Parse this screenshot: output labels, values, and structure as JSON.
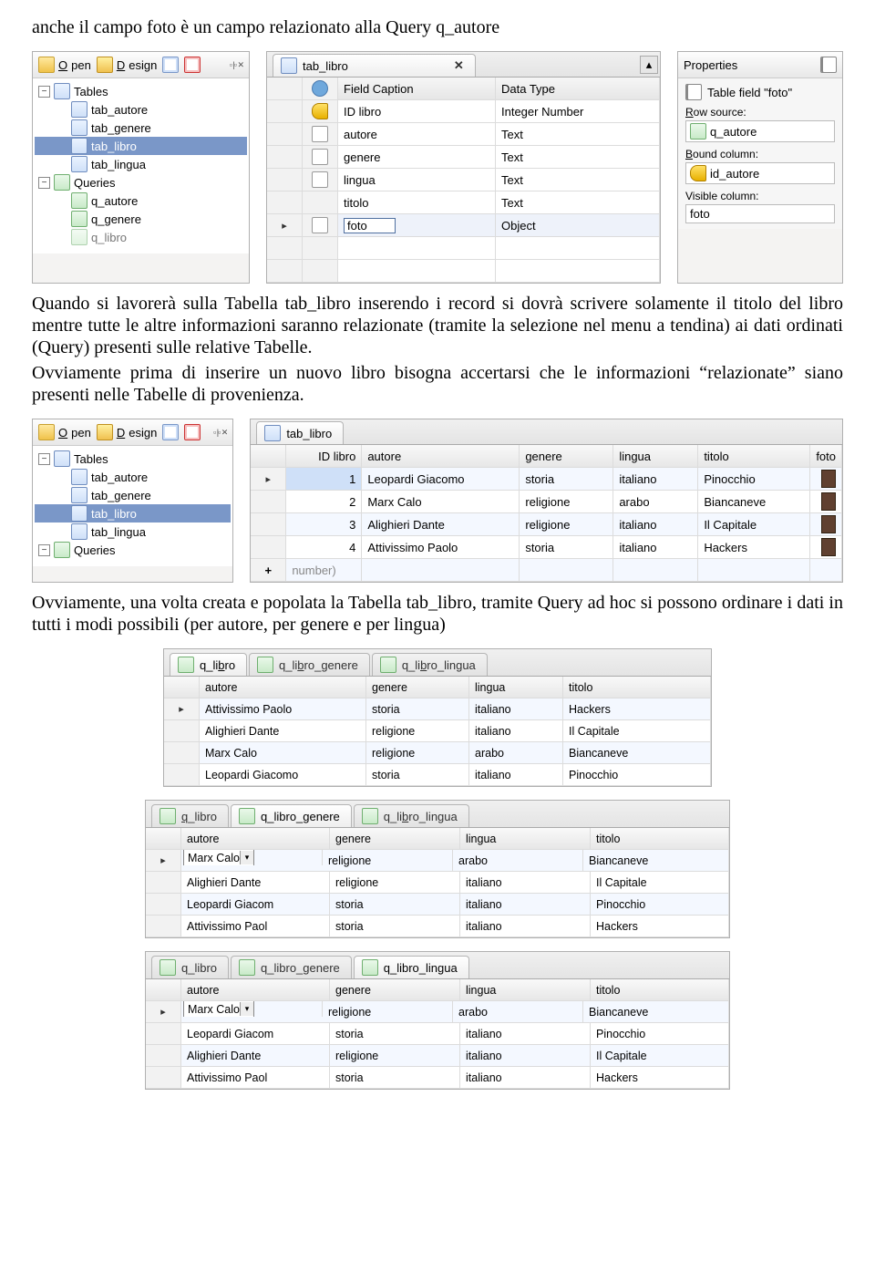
{
  "para1": "anche il campo foto è un campo relazionato alla Query q_autore",
  "para2": "Quando si lavorerà sulla Tabella tab_libro inserendo i record si dovrà scrivere solamente il titolo del libro mentre tutte le altre informazioni saranno relazionate (tramite la selezione nel menu a tendina) ai dati ordinati (Query) presenti sulle relative Tabelle.",
  "para3": "Ovviamente prima di inserire un nuovo libro bisogna accertarsi che le informazioni “relazionate” siano presenti nelle Tabelle di provenienza.",
  "para4": "Ovviamente, una volta creata e popolata la Tabella tab_libro, tramite Query ad hoc si possono ordinare i dati in tutti i modi possibili (per autore, per genere e per lingua)",
  "toolbar": {
    "open": "Open",
    "design": "Design"
  },
  "tree": {
    "tables_label": "Tables",
    "tables": [
      "tab_autore",
      "tab_genere",
      "tab_libro",
      "tab_lingua"
    ],
    "tables_selected": "tab_libro",
    "queries_label": "Queries",
    "queries": [
      "q_autore",
      "q_genere",
      "q_libro"
    ]
  },
  "design": {
    "tab": "tab_libro",
    "col_caption": "Field Caption",
    "col_type": "Data Type",
    "rows": [
      {
        "icon": "key",
        "name": "ID libro",
        "type": "Integer Number"
      },
      {
        "icon": "field",
        "name": "autore",
        "type": "Text"
      },
      {
        "icon": "field",
        "name": "genere",
        "type": "Text"
      },
      {
        "icon": "field",
        "name": "lingua",
        "type": "Text"
      },
      {
        "icon": "",
        "name": "titolo",
        "type": "Text"
      },
      {
        "icon": "field",
        "name": "foto",
        "type": "Object",
        "current": true
      }
    ]
  },
  "props": {
    "title": "Properties",
    "subtitle": "Table field \"foto\"",
    "row_source_label": "Row source:",
    "row_source": "q_autore",
    "bound_label": "Bound column:",
    "bound": "id_autore",
    "visible_label": "Visible column:",
    "visible": "foto"
  },
  "dataview": {
    "tab": "tab_libro",
    "cols": [
      "ID libro",
      "autore",
      "genere",
      "lingua",
      "titolo",
      "foto"
    ],
    "rows": [
      {
        "id": "1",
        "autore": "Leopardi Giacomo",
        "genere": "storia",
        "lingua": "italiano",
        "titolo": "Pinocchio"
      },
      {
        "id": "2",
        "autore": "Marx Calo",
        "genere": "religione",
        "lingua": "arabo",
        "titolo": "Biancaneve"
      },
      {
        "id": "3",
        "autore": "Alighieri Dante",
        "genere": "religione",
        "lingua": "italiano",
        "titolo": "Il Capitale"
      },
      {
        "id": "4",
        "autore": "Attivissimo Paolo",
        "genere": "storia",
        "lingua": "italiano",
        "titolo": "Hackers"
      }
    ],
    "newrow": "number)"
  },
  "qtabs": {
    "a": "q_libro",
    "b": "q_libro_genere",
    "c": "q_libro_lingua"
  },
  "q1": {
    "cols": [
      "autore",
      "genere",
      "lingua",
      "titolo"
    ],
    "rows": [
      [
        "Attivissimo Paolo",
        "storia",
        "italiano",
        "Hackers"
      ],
      [
        "Alighieri Dante",
        "religione",
        "italiano",
        "Il Capitale"
      ],
      [
        "Marx Calo",
        "religione",
        "arabo",
        "Biancaneve"
      ],
      [
        "Leopardi Giacomo",
        "storia",
        "italiano",
        "Pinocchio"
      ]
    ]
  },
  "q2": {
    "cols": [
      "autore",
      "genere",
      "lingua",
      "titolo"
    ],
    "rows": [
      [
        "Marx Calo",
        "religione",
        "arabo",
        "Biancaneve"
      ],
      [
        "Alighieri Dante",
        "religione",
        "italiano",
        "Il Capitale"
      ],
      [
        "Leopardi Giacom",
        "storia",
        "italiano",
        "Pinocchio"
      ],
      [
        "Attivissimo Paol",
        "storia",
        "italiano",
        "Hackers"
      ]
    ]
  },
  "q3": {
    "cols": [
      "autore",
      "genere",
      "lingua",
      "titolo"
    ],
    "rows": [
      [
        "Marx Calo",
        "religione",
        "arabo",
        "Biancaneve"
      ],
      [
        "Leopardi Giacom",
        "storia",
        "italiano",
        "Pinocchio"
      ],
      [
        "Alighieri Dante",
        "religione",
        "italiano",
        "Il Capitale"
      ],
      [
        "Attivissimo Paol",
        "storia",
        "italiano",
        "Hackers"
      ]
    ]
  }
}
